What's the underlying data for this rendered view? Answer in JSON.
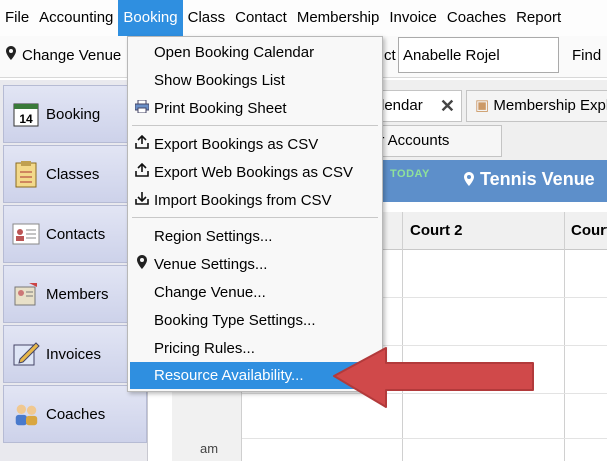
{
  "menubar": {
    "items": [
      "File",
      "Accounting",
      "Booking",
      "Class",
      "Contact",
      "Membership",
      "Invoice",
      "Coaches",
      "Report"
    ],
    "active": "Booking"
  },
  "toolbar": {
    "change_venue": "Change Venue",
    "client_label_partial": "ct",
    "client_value": "Anabelle Rojel",
    "find_label": "Find"
  },
  "sidebar": {
    "items": [
      {
        "label": "Booking",
        "icon": "calendar-icon"
      },
      {
        "label": "Classes",
        "icon": "clipboard-icon"
      },
      {
        "label": "Contacts",
        "icon": "contact-card-icon"
      },
      {
        "label": "Members",
        "icon": "members-icon"
      },
      {
        "label": "Invoices",
        "icon": "invoice-icon"
      },
      {
        "label": "Coaches",
        "icon": "coaches-icon"
      }
    ]
  },
  "tabs": {
    "calendar_tab": "lendar",
    "membership_tab": "Membership Expl",
    "accounts_tab": "er Accounts"
  },
  "banner": {
    "today": "TODAY",
    "venue": "Tennis Venue"
  },
  "grid": {
    "headers": [
      "Court 2",
      "Court"
    ],
    "time_label": "am"
  },
  "dropdown": {
    "items": [
      {
        "label": "Open Booking Calendar",
        "icon": ""
      },
      {
        "label": "Show Bookings List",
        "icon": ""
      },
      {
        "label": "Print Booking Sheet",
        "icon": "printer-icon"
      },
      {
        "label": "Export Bookings as CSV",
        "icon": "export-icon"
      },
      {
        "label": "Export Web Bookings as CSV",
        "icon": "export-icon"
      },
      {
        "label": "Import Bookings from CSV",
        "icon": "import-icon"
      },
      {
        "label": "Region Settings...",
        "icon": ""
      },
      {
        "label": "Venue Settings...",
        "icon": "location-pin-icon"
      },
      {
        "label": "Change Venue...",
        "icon": ""
      },
      {
        "label": "Booking Type Settings...",
        "icon": ""
      },
      {
        "label": "Pricing Rules...",
        "icon": ""
      },
      {
        "label": "Resource Availability...",
        "icon": ""
      }
    ],
    "highlighted": "Resource Availability..."
  },
  "colors": {
    "menu_highlight": "#2f8fe0",
    "banner": "#5d8fca",
    "arrow": "#d0494a"
  }
}
